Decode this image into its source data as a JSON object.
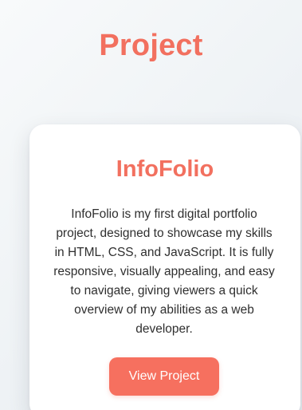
{
  "section": {
    "title": "Project"
  },
  "project_card": {
    "title": "InfoFolio",
    "description": "InfoFolio is my first digital portfolio project, designed to showcase my skills in HTML, CSS, and JavaScript. It is fully responsive, visually appealing, and easy to navigate, giving viewers a quick overview of my abilities as a web developer.",
    "button_label": "View Project"
  },
  "colors": {
    "accent": "#f2705f",
    "button": "#f6705f",
    "card_background": "#ffffff",
    "text": "#2f2f2f"
  }
}
